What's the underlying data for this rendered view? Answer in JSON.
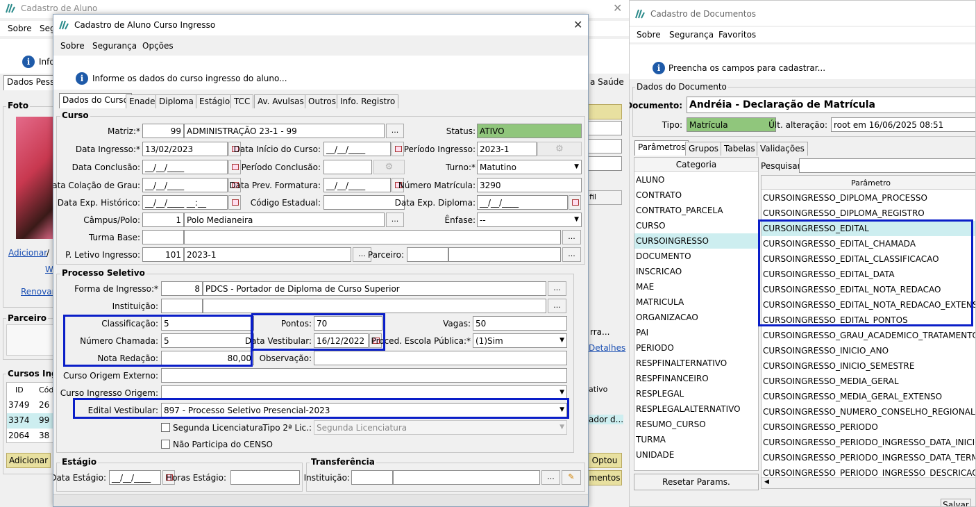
{
  "back_window": {
    "title": "Cadastro de Aluno",
    "menu": [
      "Sobre",
      "Seg"
    ],
    "info_text": "Info",
    "tab_left": "Dados Pess",
    "tab_right": "a Saúde",
    "foto_label": "Foto",
    "adicionar_link": "Adicionar",
    "slash": "/",
    "w_link": "W",
    "renovar_link": "Renovar",
    "parceiro_label": "Parceiro",
    "cursos_label": "Cursos Ingr",
    "table_headers": [
      "ID",
      "Cód"
    ],
    "table_rows": [
      {
        "id": "3749",
        "cod": "26"
      },
      {
        "id": "3374",
        "cod": "99"
      },
      {
        "id": "2064",
        "cod": "38"
      }
    ],
    "adicionar_button": "Adicionar",
    "fil_button": "fil",
    "rra_text": "rra...",
    "detalhes_link": "Detalhes",
    "ativo_header": "ativo",
    "ador_text": "ador d...",
    "optou_button": "Optou",
    "documentos_button": "mentos"
  },
  "dialog": {
    "title": "Cadastro de Aluno Curso Ingresso",
    "menu": [
      "Sobre",
      "Segurança",
      "Opções"
    ],
    "info_text": "Informe os dados do curso ingresso do aluno...",
    "tabs": [
      "Dados do Curso",
      "Enade",
      "Diploma",
      "Estágio",
      "TCC",
      "Av. Avulsas",
      "Outros",
      "Info. Registro"
    ],
    "curso": {
      "group_title": "Curso",
      "matriz_label": "Matriz:*",
      "matriz_code": "99",
      "matriz_name": "ADMINISTRAÇÃO 23-1 - 99",
      "status_label": "Status:",
      "status_value": "ATIVO",
      "data_ingresso_label": "Data Ingresso:*",
      "data_ingresso": "13/02/2023",
      "data_inicio_label": "Data Início do Curso:",
      "data_inicio": "__/__/____",
      "periodo_ingresso_label": "Período Ingresso:",
      "periodo_ingresso": "2023-1",
      "data_conclusao_label": "Data Conclusão:",
      "data_conclusao": "__/__/____",
      "periodo_conclusao_label": "Período Conclusão:",
      "periodo_conclusao": "",
      "turno_label": "Turno:*",
      "turno": "Matutino",
      "colacao_label": "Data Colação de Grau:",
      "colacao": "__/__/____",
      "prev_formatura_label": "Data Prev. Formatura:",
      "prev_formatura": "__/__/____",
      "num_matricula_label": "Número Matrícula:",
      "num_matricula": "3290",
      "exp_historico_label": "Data Exp. Histórico:",
      "exp_historico": "__/__/____ __:__",
      "codigo_estadual_label": "Código Estadual:",
      "codigo_estadual": "",
      "exp_diploma_label": "Data Exp. Diploma:",
      "exp_diploma": "__/__/____",
      "campus_label": "Câmpus/Polo:",
      "campus_code": "1",
      "campus_name": "Polo Medianeira",
      "enfase_label": "Ênfase:",
      "enfase": "--",
      "turma_base_label": "Turma Base:",
      "p_letivo_label": "P. Letivo Ingresso:",
      "p_letivo_code": "101",
      "p_letivo_name": "2023-1",
      "parceiro_label": "Parceiro:"
    },
    "processo": {
      "group_title": "Processo Seletivo",
      "forma_label": "Forma de Ingresso:*",
      "forma_code": "8",
      "forma_name": "PDCS - Portador de Diploma de Curso Superior",
      "instituicao_label": "Instituição:",
      "classificacao_label": "Classificação:",
      "classificacao": "5",
      "pontos_label": "Pontos:",
      "pontos": "70",
      "vagas_label": "Vagas:",
      "vagas": "50",
      "numero_chamada_label": "Número Chamada:",
      "numero_chamada": "5",
      "data_vestibular_label": "Data Vestibular:",
      "data_vestibular": "16/12/2022",
      "proced_label": "Proced. Escola Pública:*",
      "proced": "(1)Sim",
      "nota_redacao_label": "Nota Redação:",
      "nota_redacao": "80,00",
      "observacao_label": "Observação:",
      "curso_origem_externo_label": "Curso Origem Externo:",
      "curso_ingresso_origem_label": "Curso Ingresso Origem:",
      "edital_label": "Edital Vestibular:",
      "edital": "897 - Processo Seletivo Presencial-2023",
      "segunda_lic_label": "Segunda Licenciatura.",
      "tipo_2a_lic_label": "Tipo 2ª Lic.:",
      "tipo_2a_lic": "Segunda Licenciatura",
      "nao_participa_label": "Não Participa do CENSO"
    },
    "estagio": {
      "group_title": "Estágio",
      "data_label": "Data Estágio:",
      "data": "__/__/____",
      "horas_label": "Horas Estágio:"
    },
    "transferencia": {
      "group_title": "Transferência",
      "instituicao_label": "Instituição:"
    },
    "ellipsis": "..."
  },
  "docs_window": {
    "title": "Cadastro de Documentos",
    "menu": [
      "Sobre",
      "Segurança",
      "Favoritos"
    ],
    "info_text": "Preencha os campos para cadastrar...",
    "group_title": "Dados do Documento",
    "documento_label": "Documento:",
    "documento": "Andréia - Declaração de Matrícula",
    "tipo_label": "Tipo:",
    "tipo": "Matrícula",
    "ult_alteracao_label": "Últ. alteração:",
    "ult_alteracao": "root em 16/06/2025 08:51",
    "tabs": [
      "Parâmetros",
      "Grupos",
      "Tabelas",
      "Validações"
    ],
    "categoria_header": "Categoria",
    "pesquisar_label": "Pesquisar:",
    "parametro_header": "Parâmetro",
    "categories": [
      "ALUNO",
      "CONTRATO",
      "CONTRATO_PARCELA",
      "CURSO",
      "CURSOINGRESSO",
      "DOCUMENTO",
      "INSCRICAO",
      "MAE",
      "MATRICULA",
      "ORGANIZACAO",
      "PAI",
      "PERIODO",
      "RESPFINALTERNATIVO",
      "RESPFINANCEIRO",
      "RESPLEGAL",
      "RESPLEGALALTERNATIVO",
      "RESUMO_CURSO",
      "TURMA",
      "UNIDADE"
    ],
    "selected_category": "CURSOINGRESSO",
    "parameters": [
      "CURSOINGRESSO_DIPLOMA_PROCESSO",
      "CURSOINGRESSO_DIPLOMA_REGISTRO",
      "CURSOINGRESSO_EDITAL",
      "CURSOINGRESSO_EDITAL_CHAMADA",
      "CURSOINGRESSO_EDITAL_CLASSIFICACAO",
      "CURSOINGRESSO_EDITAL_DATA",
      "CURSOINGRESSO_EDITAL_NOTA_REDACAO",
      "CURSOINGRESSO_EDITAL_NOTA_REDACAO_EXTENSO",
      "CURSOINGRESSO_EDITAL_PONTOS",
      "CURSOINGRESSO_GRAU_ACADEMICO_TRATAMENTO",
      "CURSOINGRESSO_INICIO_ANO",
      "CURSOINGRESSO_INICIO_SEMESTRE",
      "CURSOINGRESSO_MEDIA_GERAL",
      "CURSOINGRESSO_MEDIA_GERAL_EXTENSO",
      "CURSOINGRESSO_NUMERO_CONSELHO_REGIONAL",
      "CURSOINGRESSO_PERIODO",
      "CURSOINGRESSO_PERIODO_INGRESSO_DATA_INICIO",
      "CURSOINGRESSO_PERIODO_INGRESSO_DATA_TERMINO",
      "CURSOINGRESSO_PERIODO_INGRESSO_DESCRICAO"
    ],
    "selected_parameter": "CURSOINGRESSO_EDITAL",
    "reset_button": "Resetar Params.",
    "salvar_button": "Salvar"
  },
  "colors": {
    "status_green": "#90c67c",
    "highlight_blue": "#0a1ec8",
    "selection": "#cdeef0"
  }
}
